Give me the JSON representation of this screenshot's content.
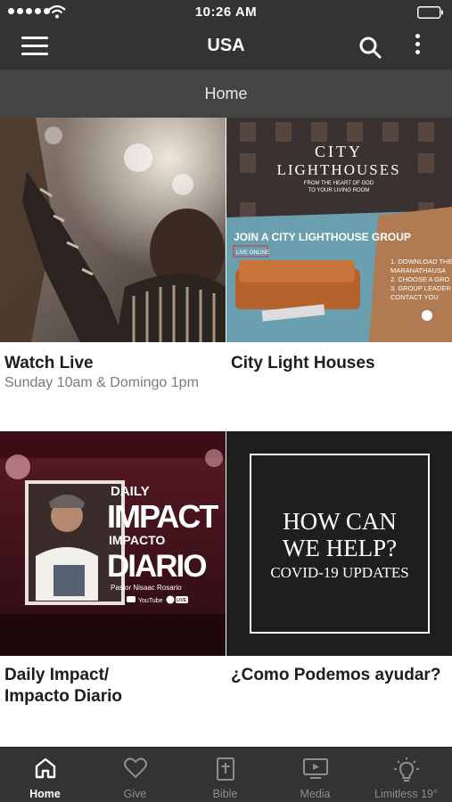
{
  "status_bar": {
    "time": "10:26 AM"
  },
  "app_bar": {
    "title": "USA"
  },
  "section": {
    "title": "Home"
  },
  "cards": [
    {
      "title": "Watch Live",
      "subtitle": "Sunday 10am & Domingo 1pm",
      "image_text": []
    },
    {
      "title": "City Light Houses",
      "subtitle": "",
      "image_text": [
        "CITY",
        "LIGHTHOUSES",
        "FROM THE HEART OF GOD",
        "TO YOUR LIVING ROOM",
        "JOIN A CITY LIGHTHOUSE GROUP",
        "LIVE ONLINE",
        "1. DOWNLOAD THE",
        "MARANATHAUSA",
        "2. CHOOSE A GRO",
        "3. GROUP LEADER",
        "CONTACT YOU"
      ]
    },
    {
      "title": "Daily Impact/\nImpacto Diario",
      "subtitle": "",
      "image_text": [
        "DAILY",
        "IMPACT",
        "IMPACTO",
        "DIARIO",
        "Pastor Nisaac Rosario",
        "YouTube",
        "LIVE"
      ]
    },
    {
      "title": "¿Como Podemos ayudar?",
      "subtitle": "",
      "image_text": [
        "HOW CAN",
        "WE HELP?",
        "COVID-19 UPDATES"
      ]
    }
  ],
  "tab_bar": {
    "tabs": [
      {
        "label": "Home",
        "icon": "home-icon",
        "active": true
      },
      {
        "label": "Give",
        "icon": "heart-icon",
        "active": false
      },
      {
        "label": "Bible",
        "icon": "bible-icon",
        "active": false
      },
      {
        "label": "Media",
        "icon": "media-icon",
        "active": false
      },
      {
        "label": "Limitless 19°",
        "icon": "lightbulb-icon",
        "active": false
      }
    ]
  },
  "colors": {
    "bar": "#333333",
    "section_bar": "#444444",
    "active_tab": "#ffffff",
    "inactive_tab": "#8e8e8e"
  }
}
